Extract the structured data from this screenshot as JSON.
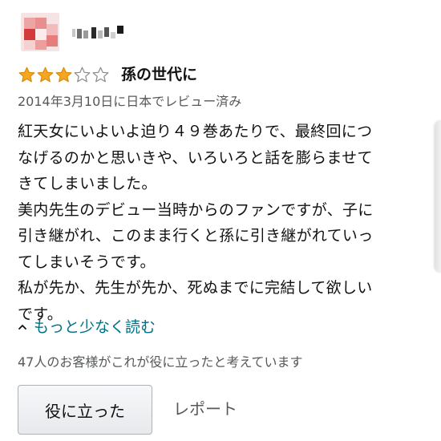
{
  "reviewer": {
    "avatar_icon": "pixelated-avatar-icon",
    "name_icon": "pixelated-name-icon"
  },
  "rating": {
    "stars_filled": 3,
    "stars_total": 5,
    "filled_color": "#f5a623",
    "empty_color": "#8a8a8a"
  },
  "review": {
    "title": "孫の世代に",
    "date": "2014年3月10日に日本でレビュー済み",
    "body_lines": [
      "紅天女にいよいよ迫り４９巻あたりで、最終回につ",
      "なげるのかと思いきや、いろいろと話を膨らませて",
      "きてしまいました。",
      "美内先生のデビュー当時からのファンですが、子に",
      "引き継がれ、このまま行くと孫に引き継がれていっ",
      "てしまいそうです。",
      "私が先か、先生が先か、死ぬまでに完結して欲しい",
      "です。"
    ],
    "read_less_label": "もっと少なく読む",
    "read_less_icon": "caret-up-icon",
    "helpful_text": "47人のお客様がこれが役に立ったと考えています",
    "helpful_button_label": "役に立った",
    "report_label": "レポート",
    "link_color": "#007185"
  }
}
